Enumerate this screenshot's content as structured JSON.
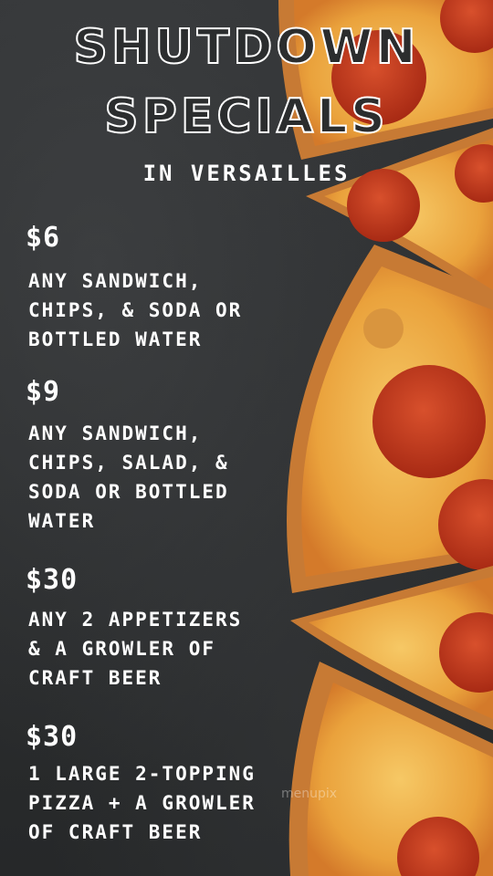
{
  "title_line1": "SHUTDOWN",
  "title_line2": "SPECIALS",
  "subtitle": "IN VERSAILLES",
  "specials": [
    {
      "price": "$6",
      "description": "ANY SANDWICH,\nCHIPS, & SODA OR\nBOTTLED WATER"
    },
    {
      "price": "$9",
      "description": "ANY SANDWICH,\nCHIPS, SALAD,  &\nSODA OR BOTTLED\nWATER"
    },
    {
      "price": "$30",
      "description": "ANY 2 APPETIZERS\n& A GROWLER OF\nCRAFT BEER"
    },
    {
      "price": "$30",
      "description": "1 LARGE 2-TOPPING\nPIZZA + A GROWLER\nOF CRAFT BEER"
    }
  ],
  "watermark": "menupix",
  "colors": {
    "background": "#2b2d2e",
    "text": "#ffffff",
    "crust": "#d88a3c",
    "cheese": "#f3b64a",
    "pepperoni": "#c23a1e"
  }
}
